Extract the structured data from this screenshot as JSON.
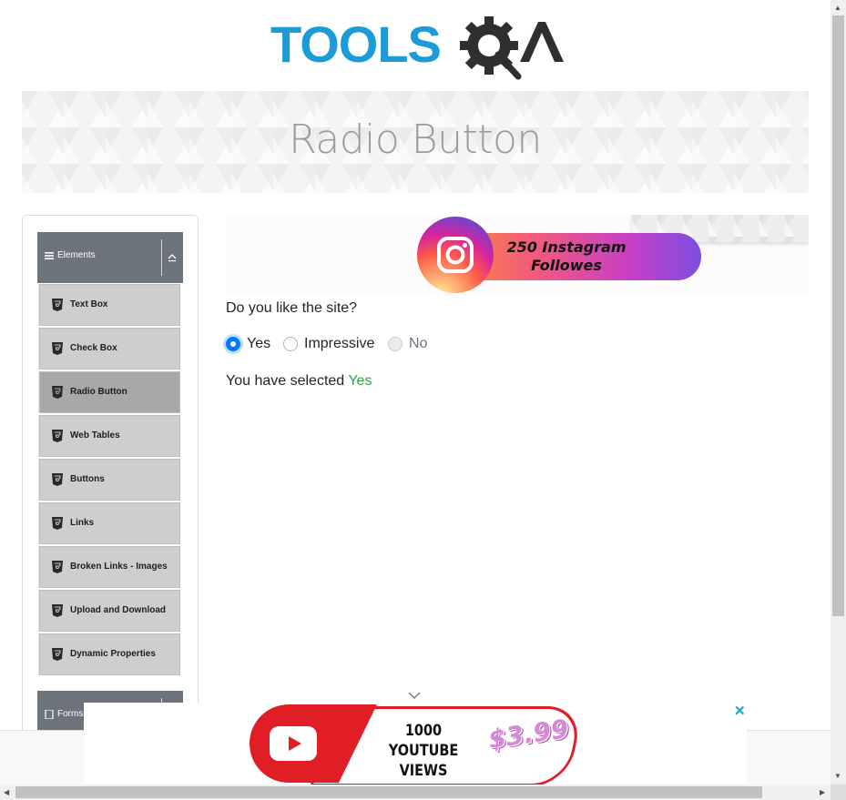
{
  "header": {
    "logo_text_tools": "TOOLS",
    "logo_text_qa": "QA",
    "page_title": "Radio Button"
  },
  "sidebar": {
    "group_elements": {
      "label": "Elements",
      "icon": "hamburger-icon",
      "toggle_icon": "collapse-up-icon"
    },
    "items": [
      {
        "label": "Text Box",
        "icon": "html5-icon",
        "active": false
      },
      {
        "label": "Check Box",
        "icon": "html5-icon",
        "active": false
      },
      {
        "label": "Radio Button",
        "icon": "html5-icon",
        "active": true
      },
      {
        "label": "Web Tables",
        "icon": "html5-icon",
        "active": false
      },
      {
        "label": "Buttons",
        "icon": "html5-icon",
        "active": false
      },
      {
        "label": "Links",
        "icon": "html5-icon",
        "active": false
      },
      {
        "label": "Broken Links - Images",
        "icon": "html5-icon",
        "active": false
      },
      {
        "label": "Upload and Download",
        "icon": "html5-icon",
        "active": false
      },
      {
        "label": "Dynamic Properties",
        "icon": "html5-icon",
        "active": false
      }
    ],
    "group_forms": {
      "label": "Forms",
      "icon": "document-icon"
    }
  },
  "ad_top": {
    "text_line1": "250 Instagram",
    "text_line2": "Followes",
    "icon": "instagram-icon"
  },
  "main": {
    "question": "Do you like the site?",
    "options": [
      {
        "label": "Yes",
        "checked": true,
        "disabled": false
      },
      {
        "label": "Impressive",
        "checked": false,
        "disabled": false
      },
      {
        "label": "No",
        "checked": false,
        "disabled": true
      }
    ],
    "result_prefix": "You have selected",
    "result_value": "Yes"
  },
  "ad_bottom": {
    "line1": "1000",
    "line2": "YOUTUBE VIEWS",
    "price": "$3.99",
    "close": "✕",
    "icon": "youtube-icon"
  },
  "colors": {
    "accent": "#007bff",
    "success": "#28a745",
    "sidebar_header": "#6c737b",
    "logo_blue": "#1b9bd7",
    "logo_dark": "#2f2f2f"
  }
}
